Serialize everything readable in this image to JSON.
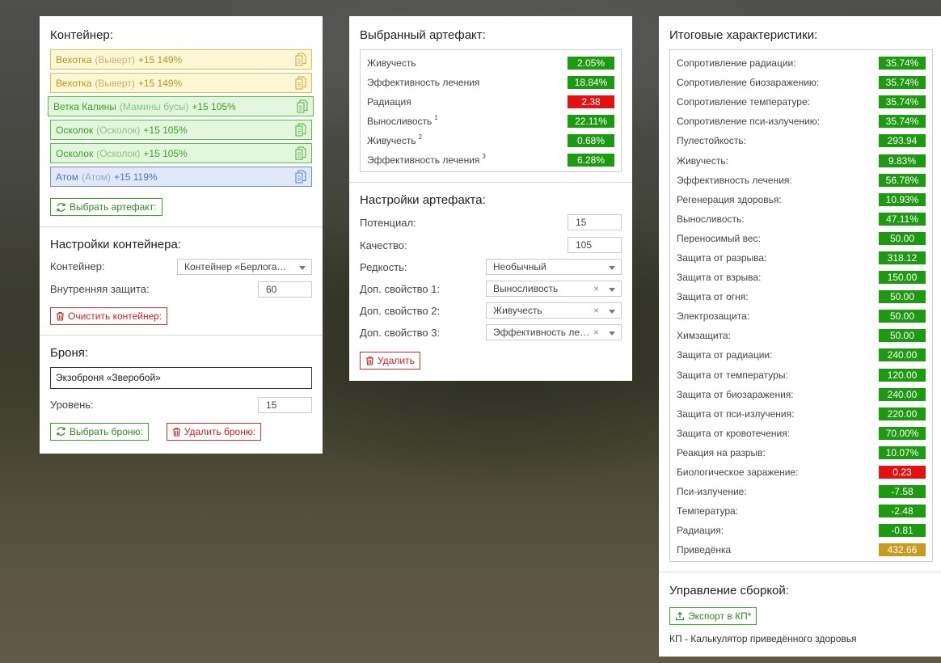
{
  "container_panel": {
    "title": "Контейнер:",
    "artifacts": [
      {
        "name": "Вехотка",
        "alt": "(Выверт)",
        "bonus": "+15 149%",
        "color": "yellow"
      },
      {
        "name": "Вехотка",
        "alt": "(Выверт)",
        "bonus": "+15 149%",
        "color": "yellow"
      },
      {
        "name": "Ветка Калины",
        "alt": "(Мамины бусы)",
        "bonus": "+15 105%",
        "color": "green"
      },
      {
        "name": "Осколок",
        "alt": "(Осколок)",
        "bonus": "+15 105%",
        "color": "green"
      },
      {
        "name": "Осколок",
        "alt": "(Осколок)",
        "bonus": "+15 105%",
        "color": "green"
      },
      {
        "name": "Атом",
        "alt": "(Атом)",
        "bonus": "+15 119%",
        "color": "blue"
      }
    ],
    "select_artifact_label": "Выбрать артефакт:",
    "settings_title": "Настройки контейнера:",
    "container_label": "Контейнер:",
    "container_value": "Контейнер «Берлога…",
    "inner_protection_label": "Внутренняя защита:",
    "inner_protection_value": "60",
    "clear_label": "Очистить контейнер:",
    "armor_title": "Броня:",
    "armor_value": "Экзоброня «Зверобой»",
    "level_label": "Уровень:",
    "level_value": "15",
    "select_armor_label": "Выбрать броню:",
    "delete_armor_label": "Удалить броню:"
  },
  "artifact_panel": {
    "title": "Выбранный артефакт:",
    "stats": [
      {
        "label": "Живучесть",
        "sup": "",
        "value": "2.05%",
        "color": "green"
      },
      {
        "label": "Эффективность лечения",
        "sup": "",
        "value": "18.84%",
        "color": "green"
      },
      {
        "label": "Радиация",
        "sup": "",
        "value": "2.38",
        "color": "red"
      },
      {
        "label": "Выносливость",
        "sup": "1",
        "value": "22.11%",
        "color": "green"
      },
      {
        "label": "Живучесть",
        "sup": "2",
        "value": "0.68%",
        "color": "green"
      },
      {
        "label": "Эффективность лечения",
        "sup": "3",
        "value": "6.28%",
        "color": "green"
      }
    ],
    "settings_title": "Настройки артефакта:",
    "potential_label": "Потенциал:",
    "potential_value": "15",
    "quality_label": "Качество:",
    "quality_value": "105",
    "rarity_label": "Редкость:",
    "rarity_value": "Необычный",
    "prop1_label": "Доп. свойство 1:",
    "prop1_value": "Выносливость",
    "prop2_label": "Доп. свойство 2:",
    "prop2_value": "Живучесть",
    "prop3_label": "Доп. свойство 3:",
    "prop3_value": "Эффективность ле…",
    "delete_label": "Удалить"
  },
  "totals_panel": {
    "title": "Итоговые характеристики:",
    "stats": [
      {
        "label": "Сопротивление радиации:",
        "value": "35.74%",
        "color": "green"
      },
      {
        "label": "Сопротивление биозаражению:",
        "value": "35.74%",
        "color": "green"
      },
      {
        "label": "Сопротивление температуре:",
        "value": "35.74%",
        "color": "green"
      },
      {
        "label": "Сопротивление пси-излучению:",
        "value": "35.74%",
        "color": "green"
      },
      {
        "label": "Пулестойкость:",
        "value": "293.94",
        "color": "green"
      },
      {
        "label": "Живучесть:",
        "value": "9.83%",
        "color": "green"
      },
      {
        "label": "Эффективность лечения:",
        "value": "56.78%",
        "color": "green"
      },
      {
        "label": "Регенерация здоровья:",
        "value": "10.93%",
        "color": "green"
      },
      {
        "label": "Выносливость:",
        "value": "47.11%",
        "color": "green"
      },
      {
        "label": "Переносимый вес:",
        "value": "50.00",
        "color": "green"
      },
      {
        "label": "Защита от разрыва:",
        "value": "318.12",
        "color": "green"
      },
      {
        "label": "Защита от взрыва:",
        "value": "150.00",
        "color": "green"
      },
      {
        "label": "Защита от огня:",
        "value": "50.00",
        "color": "green"
      },
      {
        "label": "Электрозащита:",
        "value": "50.00",
        "color": "green"
      },
      {
        "label": "Химзащита:",
        "value": "50.00",
        "color": "green"
      },
      {
        "label": "Защита от радиации:",
        "value": "240.00",
        "color": "green"
      },
      {
        "label": "Защита от температуры:",
        "value": "120.00",
        "color": "green"
      },
      {
        "label": "Защита от биозаражения:",
        "value": "240.00",
        "color": "green"
      },
      {
        "label": "Защита от пси-излучения:",
        "value": "220.00",
        "color": "green"
      },
      {
        "label": "Защита от кровотечения:",
        "value": "70.00%",
        "color": "green"
      },
      {
        "label": "Реакция на разрыв:",
        "value": "10.07%",
        "color": "green"
      },
      {
        "label": "Биологическое заражение:",
        "value": "0.23",
        "color": "red"
      },
      {
        "label": "Пси-излучение:",
        "value": "-7.58",
        "color": "green"
      },
      {
        "label": "Температура:",
        "value": "-2.48",
        "color": "green"
      },
      {
        "label": "Радиация:",
        "value": "-0.81",
        "color": "green"
      },
      {
        "label": "Приведёнка",
        "value": "432.66",
        "color": "gold"
      }
    ],
    "build_title": "Управление сборкой:",
    "export_label": "Экспорт в КП*",
    "footnote": "КП - Калькулятор приведённого здоровья"
  },
  "colors": {
    "green_badge": "#1d9a12",
    "red_badge": "#e01212",
    "gold_badge": "#c89a1e"
  }
}
